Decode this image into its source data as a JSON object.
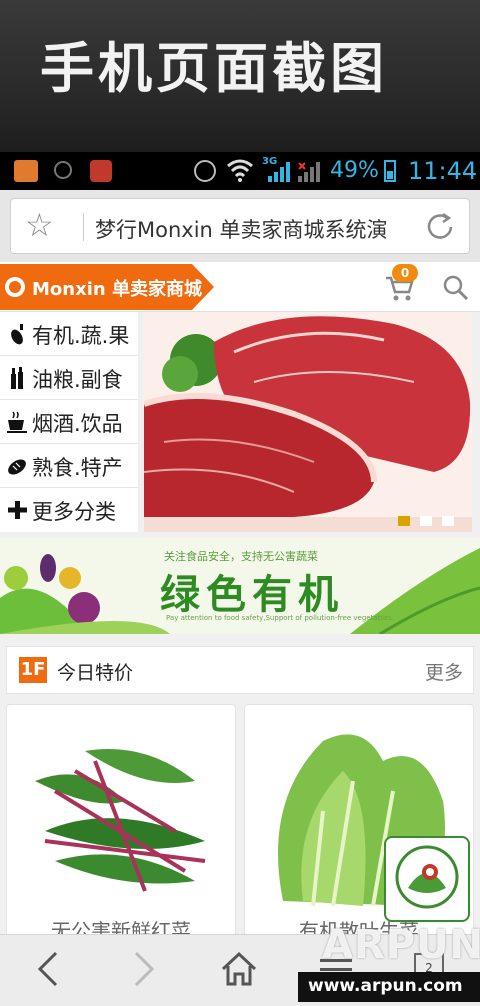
{
  "banner": {
    "title": "手机页面截图"
  },
  "status_bar": {
    "network_label": "3G",
    "battery_percent": "49%",
    "time": "11:44"
  },
  "address_bar": {
    "url_text": "梦行Monxin 单卖家商城系统演",
    "bookmark_icon": "star-icon",
    "reload_icon": "reload-icon"
  },
  "header": {
    "brand": "Monxin 单卖家商城",
    "cart_count": "0",
    "cart_icon": "cart-icon",
    "search_icon": "search-icon"
  },
  "categories": [
    {
      "label": "有机.蔬.果",
      "icon": "eggplant-icon"
    },
    {
      "label": "油粮.副食",
      "icon": "bottle-icon"
    },
    {
      "label": "烟酒.饮品",
      "icon": "cup-icon"
    },
    {
      "label": "熟食.特产",
      "icon": "bread-icon"
    },
    {
      "label": "更多分类",
      "icon": "plus-icon"
    }
  ],
  "slider": {
    "slide_count": 3,
    "active_index": 0
  },
  "promo": {
    "subtitle": "关注食品安全，支持无公害蔬菜",
    "title": "绿色有机",
    "english": "Pay attention to food safety,Support of pollution-free vegetables."
  },
  "section": {
    "badge": "1F",
    "title": "今日特价",
    "more": "更多"
  },
  "products": [
    {
      "name": "无公害新鲜红菜"
    },
    {
      "name": "有机散叶生菜"
    }
  ],
  "bottom_nav": {
    "tabs_count": "2"
  },
  "watermark": {
    "big": "ARPUN",
    "url": "www.arpun.com"
  },
  "colors": {
    "brand_orange": "#f06a10",
    "status_blue": "#33b5e5",
    "promo_green": "#2e8b22"
  }
}
